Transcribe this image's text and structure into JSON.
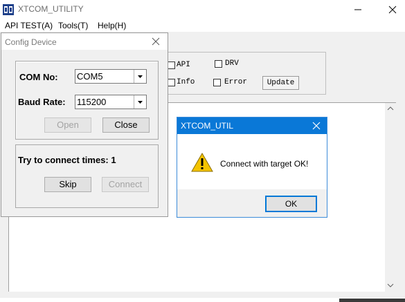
{
  "app": {
    "title": "XTCOM_UTILITY",
    "menu": [
      "API TEST(A)",
      "Tools(T)",
      "Help(H)"
    ]
  },
  "options": {
    "api_label": "API",
    "drv_label": "DRV",
    "info_label": "Info",
    "error_label": "Error",
    "update_label": "Update"
  },
  "config_dialog": {
    "title": "Config Device",
    "com_label": "COM No:",
    "com_value": "COM5",
    "baud_label": "Baud Rate:",
    "baud_value": "115200",
    "open_label": "Open",
    "close_label": "Close",
    "connect_times_text": "Try to connect times: 1",
    "skip_label": "Skip",
    "connect_label": "Connect"
  },
  "message_box": {
    "title": "XTCOM_UTIL",
    "message": "Connect with target OK!",
    "ok_label": "OK"
  },
  "colors": {
    "accent": "#0a78d7",
    "warning": "#f4c400"
  }
}
